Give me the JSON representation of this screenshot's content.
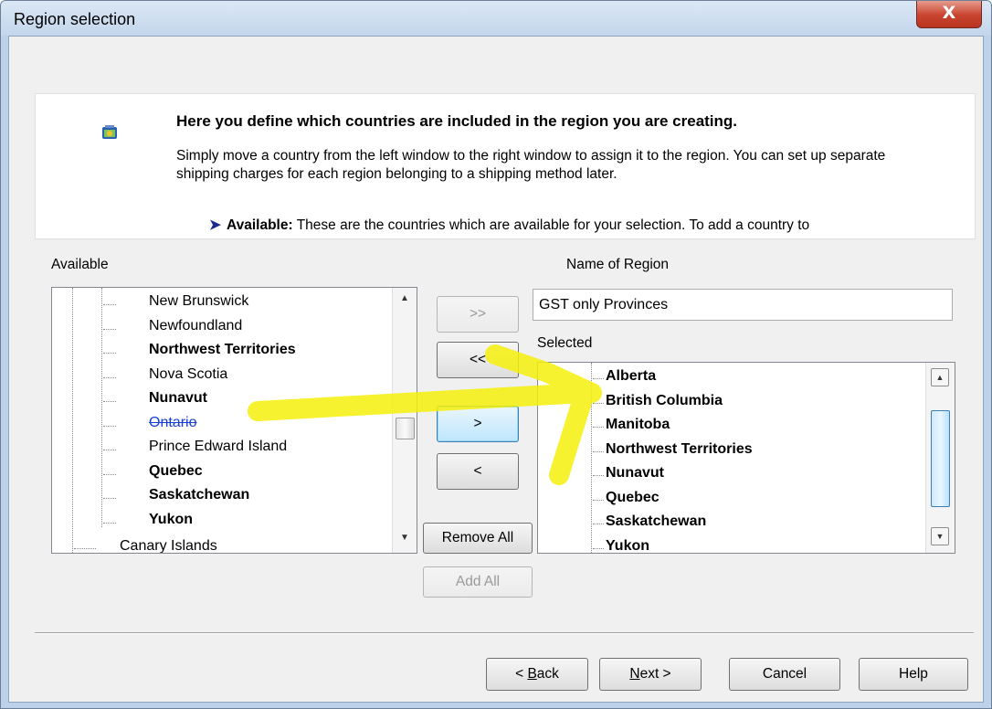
{
  "window": {
    "title": "Region selection",
    "close_label": "X"
  },
  "description": {
    "title": "Here you define which countries are included in the region you are creating.",
    "text": "Simply move a country from the left window to the right window to assign it to the region. You can set up separate shipping charges for each region belonging to a shipping method later.",
    "available_term": "Available:",
    "available_text": "These are the countries which are available for your selection. To add a country to"
  },
  "available": {
    "label": "Available",
    "items": [
      {
        "label": "New Brunswick",
        "bold": false,
        "struck": false
      },
      {
        "label": "Newfoundland",
        "bold": false,
        "struck": false
      },
      {
        "label": "Northwest Territories",
        "bold": true,
        "struck": false
      },
      {
        "label": "Nova Scotia",
        "bold": false,
        "struck": false
      },
      {
        "label": "Nunavut",
        "bold": true,
        "struck": false
      },
      {
        "label": "Ontario",
        "bold": false,
        "struck": true
      },
      {
        "label": "Prince Edward Island",
        "bold": false,
        "struck": false
      },
      {
        "label": "Quebec",
        "bold": true,
        "struck": false
      },
      {
        "label": "Saskatchewan",
        "bold": true,
        "struck": false
      },
      {
        "label": "Yukon",
        "bold": true,
        "struck": false
      }
    ],
    "parent_sibling": "Canary Islands"
  },
  "buttons": {
    "add_all_right": ">>",
    "remove_all_left": "<<",
    "add_one": ">",
    "remove_one": "<",
    "remove_all": "Remove All",
    "add_all": "Add All"
  },
  "region": {
    "name_label": "Name of Region",
    "name_value": "GST only Provinces",
    "selected_label": "Selected",
    "selected_items": [
      "Alberta",
      "British Columbia",
      "Manitoba",
      "Northwest Territories",
      "Nunavut",
      "Quebec",
      "Saskatchewan",
      "Yukon"
    ]
  },
  "footer": {
    "back_prefix": "< ",
    "back_key": "B",
    "back_rest": "ack",
    "next_key": "N",
    "next_rest": "ext >",
    "cancel": "Cancel",
    "help": "Help"
  },
  "colors": {
    "highlight": "#f5f00a",
    "accent": "#3c7fb1"
  }
}
